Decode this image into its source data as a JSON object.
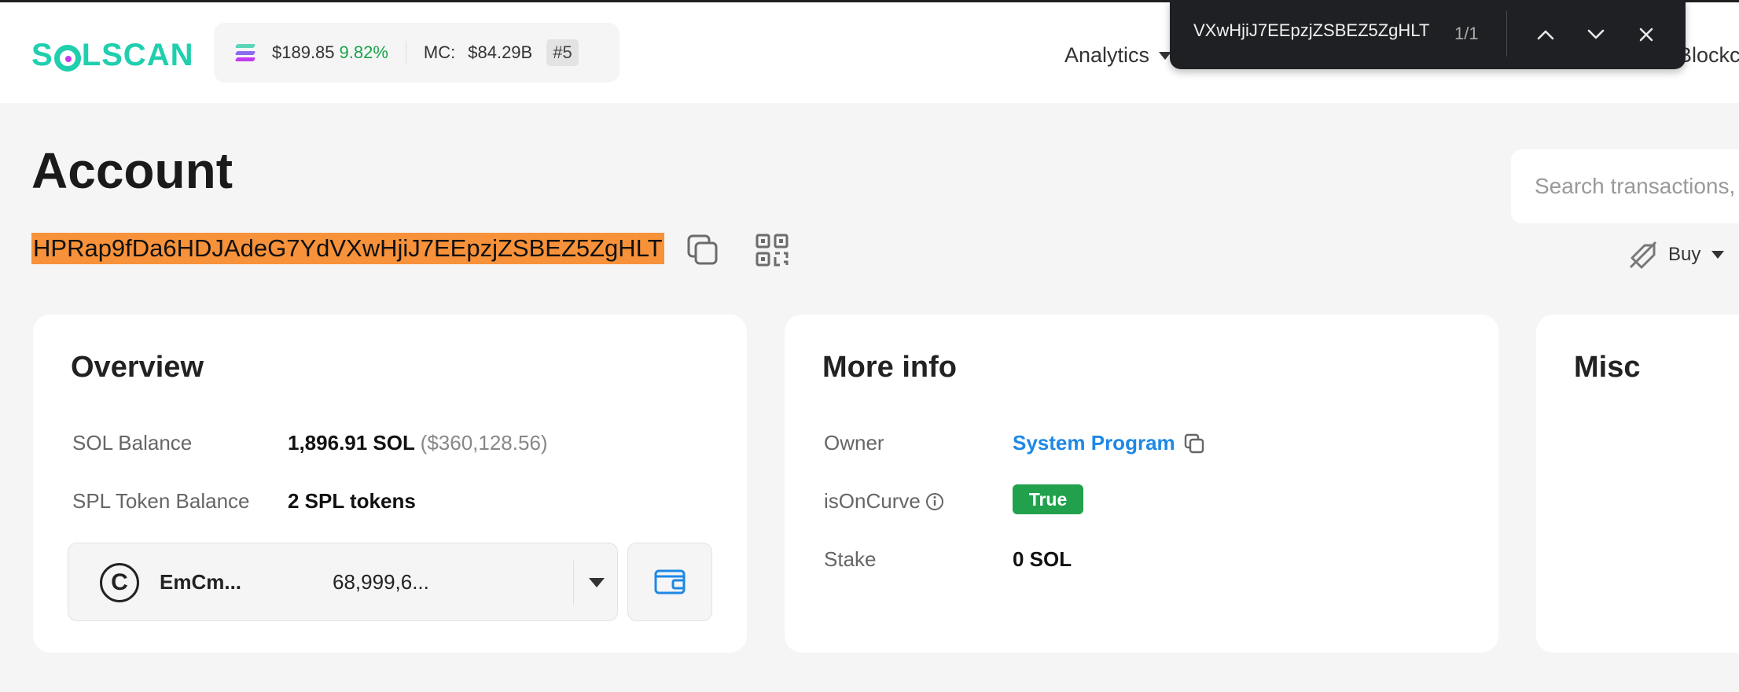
{
  "header": {
    "logo_text_pre": "S",
    "logo_text_post": "LSCAN",
    "price": "$189.85",
    "change": "9.82%",
    "mc_label": "MC:",
    "mc_value": "$84.29B",
    "rank": "#5",
    "nav_analytics": "Analytics",
    "nav_blockchain": "Blockc"
  },
  "findbar": {
    "query": "VXwHjiJ7EEpzjZSBEZ5ZgHLT",
    "count": "1/1"
  },
  "account": {
    "title": "Account",
    "address": "HPRap9fDa6HDJAdeG7YdVXwHjiJ7EEpzjZSBEZ5ZgHLT",
    "search_placeholder": "Search transactions,",
    "buy_label": "Buy"
  },
  "overview": {
    "title": "Overview",
    "sol_balance_label": "SOL Balance",
    "sol_balance_value": "1,896.91 SOL",
    "sol_balance_usd": "($360,128.56)",
    "spl_label": "SPL Token Balance",
    "spl_value": "2 SPL tokens",
    "token_icon_letter": "C",
    "token_name": "EmCm...",
    "token_amount": "68,999,6..."
  },
  "more_info": {
    "title": "More info",
    "owner_label": "Owner",
    "owner_value": "System Program",
    "oncurve_label": "isOnCurve",
    "oncurve_value": "True",
    "stake_label": "Stake",
    "stake_value": "0 SOL"
  },
  "misc": {
    "title": "Misc"
  },
  "colors": {
    "brand": "#1fcfae",
    "highlight": "#f7923a",
    "link": "#1e88e5",
    "success": "#21a14c",
    "positive": "#17a34a"
  }
}
